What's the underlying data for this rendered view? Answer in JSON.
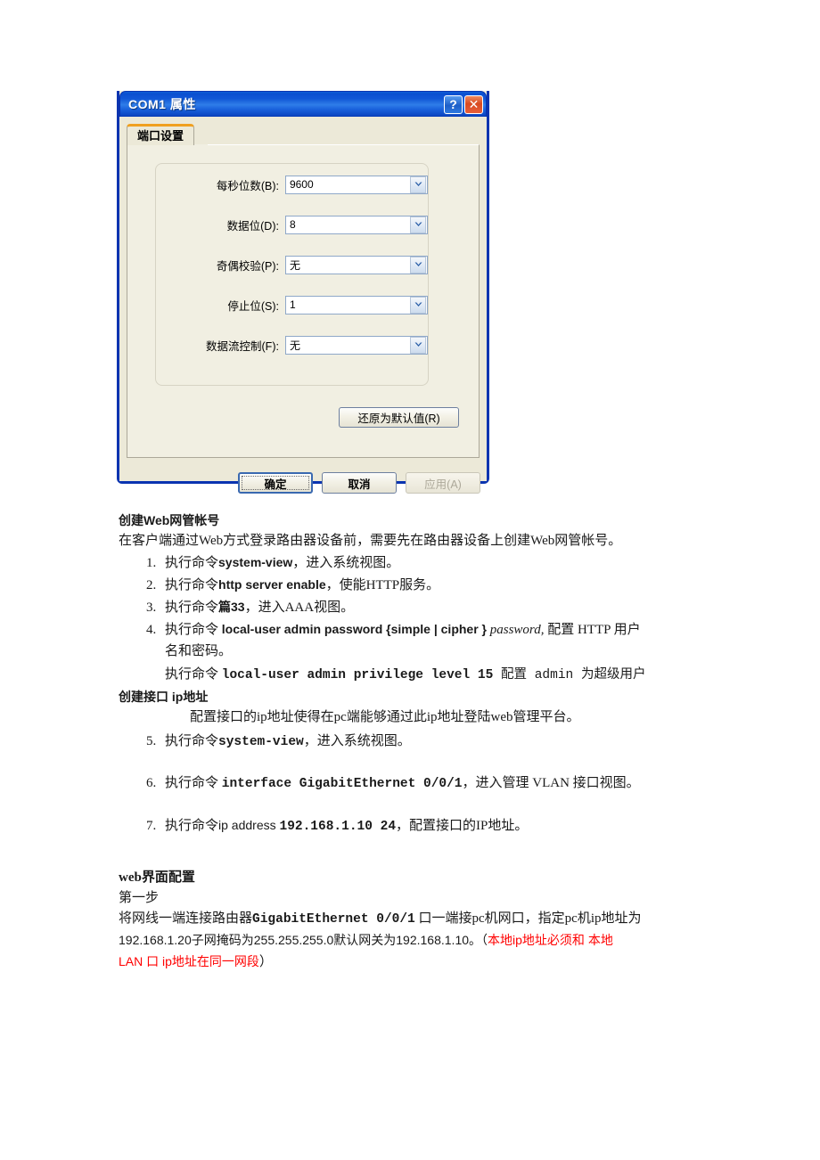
{
  "dialog": {
    "title": "COM1 属性",
    "titlebar_buttons": [
      {
        "name": "help-button",
        "glyph": "?"
      },
      {
        "name": "close-button",
        "glyph": "✕"
      }
    ],
    "tab": {
      "label": "端口设置"
    },
    "fields": [
      {
        "label": "每秒位数(B):",
        "value": "9600"
      },
      {
        "label": "数据位(D):",
        "value": "8"
      },
      {
        "label": "奇偶校验(P):",
        "value": "无"
      },
      {
        "label": "停止位(S):",
        "value": "1"
      },
      {
        "label": "数据流控制(F):",
        "value": "无"
      }
    ],
    "restore_defaults_label": "还原为默认值(R)",
    "ok_label": "确定",
    "cancel_label": "取消",
    "apply_label": "应用(A)",
    "colors": {
      "titlebar_blue": "#0b4fd0",
      "dialog_face": "#ece9d8",
      "tab_accent_orange": "#f0a020",
      "close_red": "#d84a22"
    }
  },
  "doc": {
    "section1_heading": "创建Web网管帐号",
    "section1_intro": "在客户端通过Web方式登录路由器设备前，需要先在路由器设备上创建Web网管帐号。",
    "steps_a": [
      {
        "prefix": "执行命令",
        "cmd": "system-view",
        "cmd_style": "sans-b",
        "suffix": "，进入系统视图。"
      },
      {
        "prefix": "执行命令",
        "cmd": "http server enable",
        "cmd_style": "sans-b",
        "suffix": "，使能HTTP服务。"
      },
      {
        "prefix": "执行命令",
        "cmd": "篇33",
        "cmd_style": "sans-b",
        "suffix": "，进入AAA视图。"
      }
    ],
    "step4": {
      "prefix": "执行命令 ",
      "cmd_bold": "local-user admin password {simple | cipher }",
      "cmd_italic": " password,",
      "suffix": " 配置 HTTP 用户",
      "line2": "名和密码。"
    },
    "step4_extra": {
      "prefix": "执行命令 ",
      "cmd": "local-user admin privilege level 15",
      "suffix": " 配置 admin 为超级用户"
    },
    "section2_heading": "创建接口 ip地址",
    "section2_intro": "配置接口的ip地址使得在pc端能够通过此ip地址登陆web管理平台。",
    "steps_b": [
      {
        "prefix": "执行命令",
        "cmd": "system-view",
        "cmd_style": "mono-b",
        "suffix": "，进入系统视图。"
      },
      {
        "prefix": "执行命令 ",
        "cmd": "interface GigabitEthernet 0/0/1",
        "cmd_style": "mono-b",
        "suffix": "，进入管理 VLAN 接口视图。"
      },
      {
        "prefix": "执行命令",
        "cmd_small": "ip address ",
        "cmd": "192.168.1.10 24",
        "cmd_style": "mono-b",
        "suffix": "，配置接口的IP地址。"
      }
    ],
    "section3_heading": "web界面配置",
    "section3_sub": "第一步",
    "section3_line1_pre": "将网线一端连接路由器",
    "section3_line1_cmd": "GigabitEthernet 0/0/1",
    "section3_line1_post": " 口一端接pc机网口，指定pc机ip地址为",
    "section3_line2_black": "192.168.1.20子网掩码为255.255.255.0默认网关为192.168.1.10。（",
    "section3_line2_red": "本地ip地址必须和 本地",
    "section3_line3_red": "LAN 口 ip地址在同一网段",
    "section3_line3_black": "）",
    "red_color": "#ff0000"
  }
}
